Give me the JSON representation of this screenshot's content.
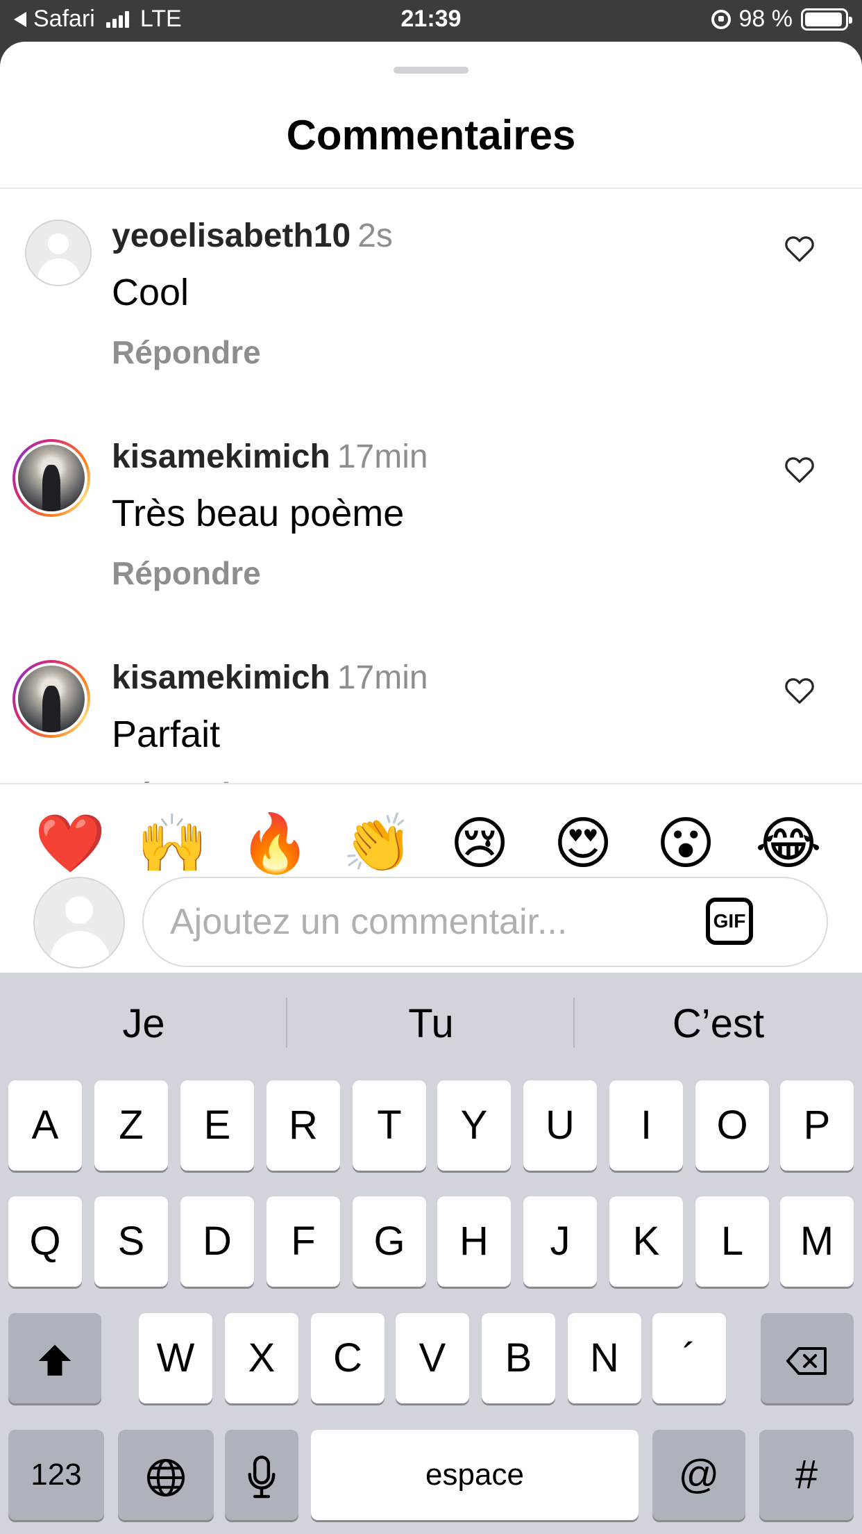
{
  "status_bar": {
    "back_app": "Safari",
    "network": "LTE",
    "time": "21:39",
    "battery": "98 %"
  },
  "sheet": {
    "title": "Commentaires"
  },
  "comments": [
    {
      "username": "yeoelisabeth10",
      "time": "2s",
      "text": "Cool",
      "reply": "Répondre",
      "avatar": "default-avatar"
    },
    {
      "username": "kisamekimich",
      "time": "17min",
      "text": "Très beau poème",
      "reply": "Répondre",
      "avatar": "story-avatar"
    },
    {
      "username": "kisamekimich",
      "time": "17min",
      "text": "Parfait",
      "reply": "Répondre",
      "avatar": "story-avatar"
    }
  ],
  "emoji_bar": [
    {
      "name": "red-heart",
      "glyph": "❤️"
    },
    {
      "name": "raising-hands",
      "glyph": "🙌"
    },
    {
      "name": "fire",
      "glyph": "🔥"
    },
    {
      "name": "clapping-hands",
      "glyph": "👏"
    },
    {
      "name": "crying-face",
      "glyph": "😢"
    },
    {
      "name": "heart-eyes",
      "glyph": "😍"
    },
    {
      "name": "surprised-face",
      "glyph": "😮"
    },
    {
      "name": "tears-of-joy",
      "glyph": "😂"
    }
  ],
  "comment_input": {
    "placeholder": "Ajoutez un commentair...",
    "gif_label": "GIF"
  },
  "keyboard": {
    "suggestions": [
      "Je",
      "Tu",
      "C’est"
    ],
    "row1": [
      "A",
      "Z",
      "E",
      "R",
      "T",
      "Y",
      "U",
      "I",
      "O",
      "P"
    ],
    "row2": [
      "Q",
      "S",
      "D",
      "F",
      "G",
      "H",
      "J",
      "K",
      "L",
      "M"
    ],
    "row3": [
      "W",
      "X",
      "C",
      "V",
      "B",
      "N",
      "´"
    ],
    "numbers_key": "123",
    "space_key": "espace",
    "at_key": "@",
    "hash_key": "#"
  }
}
